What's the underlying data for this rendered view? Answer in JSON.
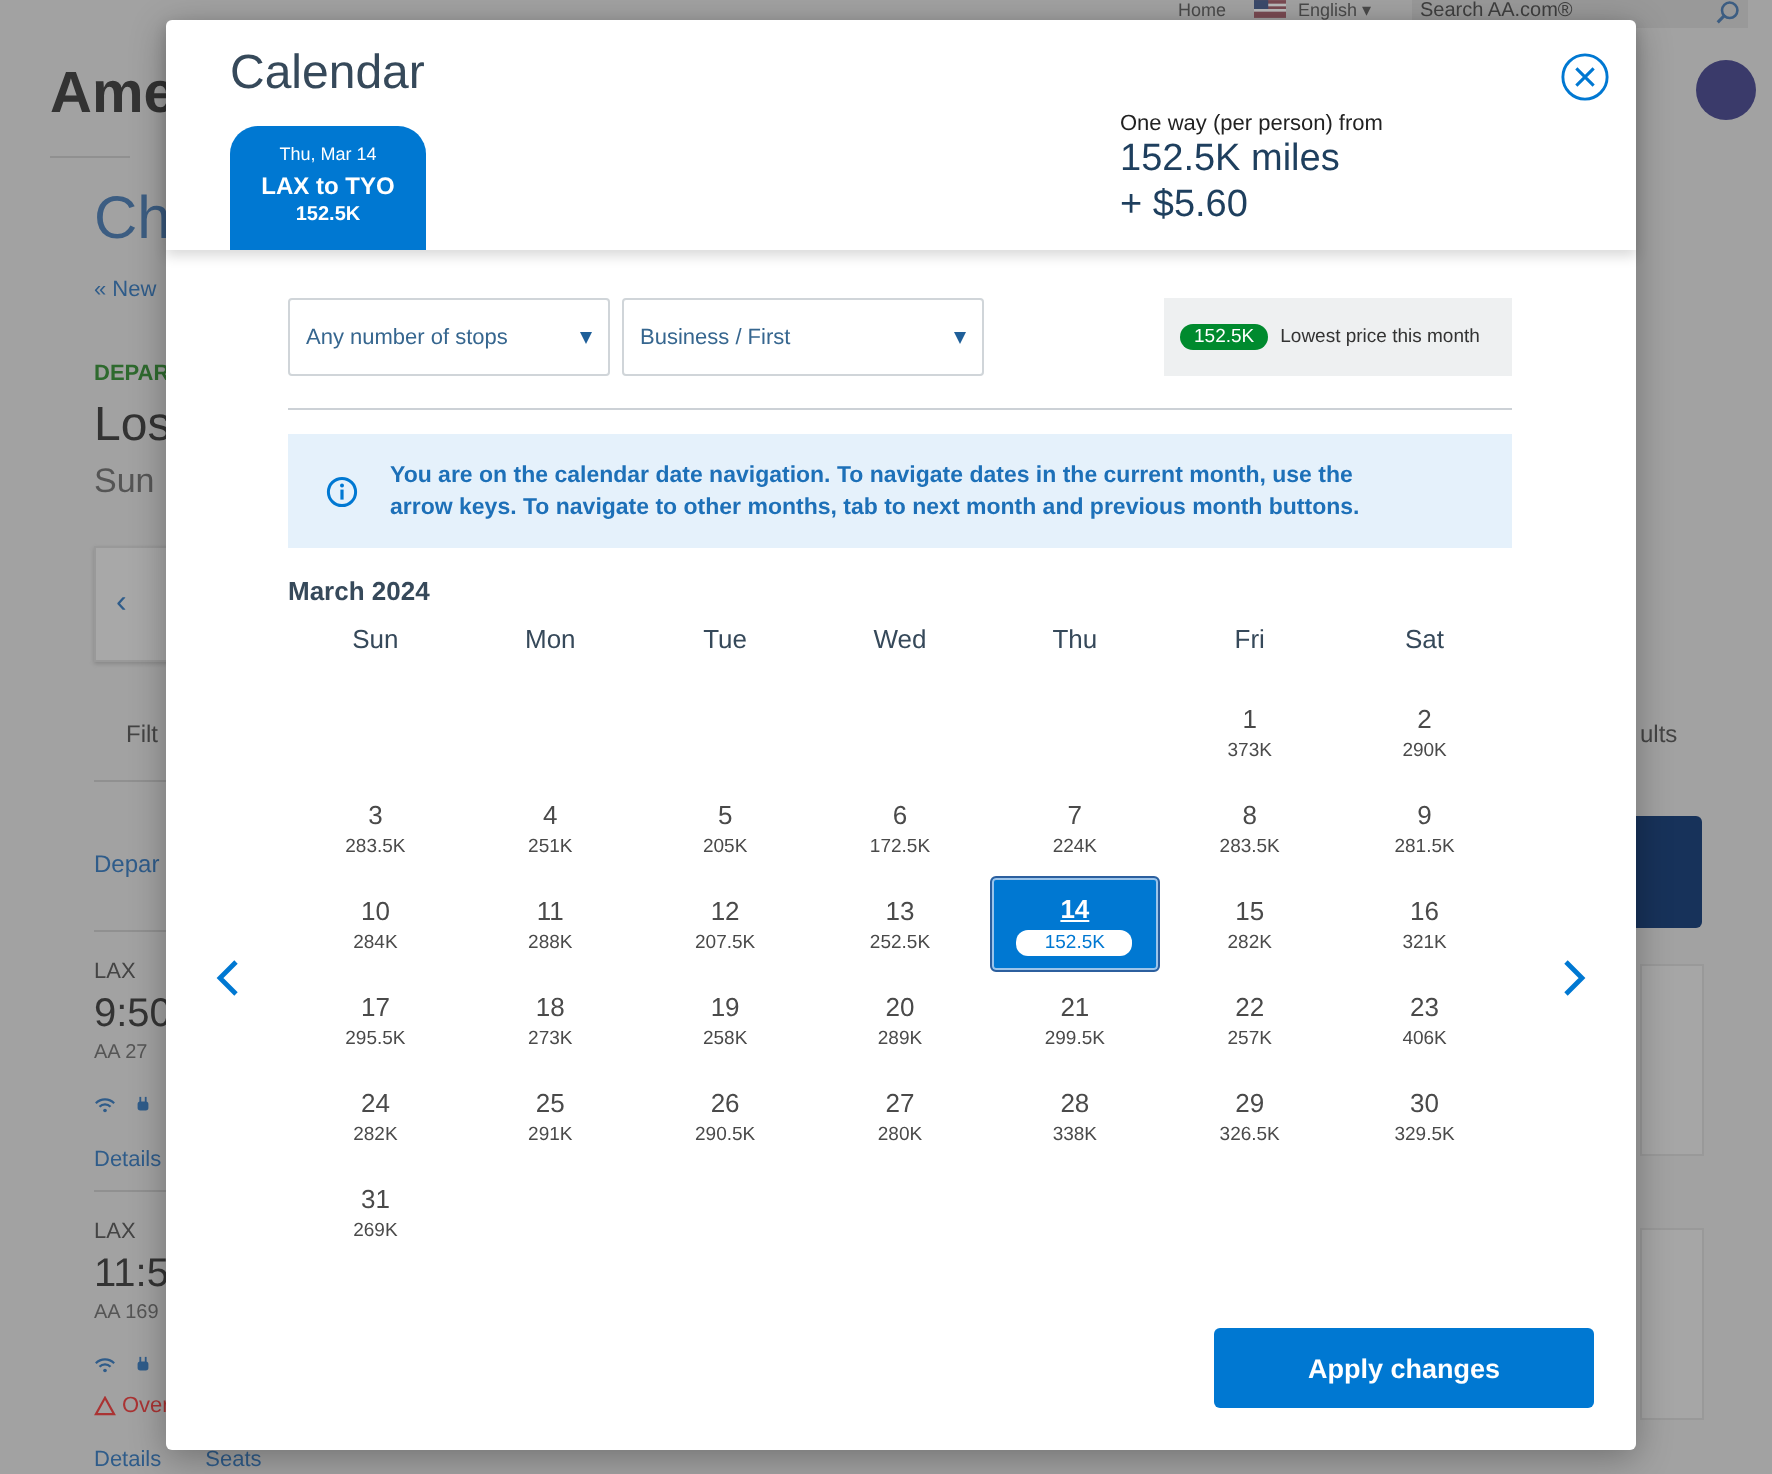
{
  "background": {
    "top_links": [
      "Home",
      "English ▾"
    ],
    "search": {
      "placeholder": "Search AA.com®"
    },
    "logo": "Ame",
    "heading": "Ch",
    "back_link": "« New",
    "section_label": "DEPAR",
    "city": "Los",
    "date": "Sun",
    "prev_arrow": "‹",
    "filter": "Filt",
    "results": "ults",
    "sort": "Depar",
    "flights": [
      {
        "origin": "LAX",
        "time": "9:50",
        "flight": "AA 27",
        "links": [
          "Details"
        ]
      },
      {
        "origin": "LAX",
        "time": "11:5",
        "flight": "AA 169",
        "warning": "Over",
        "links": [
          "Details",
          "Seats"
        ]
      }
    ]
  },
  "modal": {
    "title": "Calendar",
    "tab": {
      "date": "Thu, Mar 14",
      "route": "LAX to TYO",
      "price": "152.5K"
    },
    "fare": {
      "label": "One way (per person) from",
      "miles": "152.5K miles",
      "cash": "+ $5.60"
    },
    "filters": [
      {
        "value": "Any number of stops"
      },
      {
        "value": "Business / First"
      }
    ],
    "legend": {
      "badge": "152.5K",
      "text": "Lowest price this month"
    },
    "info": "You are on the calendar date navigation. To navigate dates in the current month, use the arrow keys. To navigate to other months, tab to next month and previous month buttons.",
    "month": "March 2024",
    "weekdays": [
      "Sun",
      "Mon",
      "Tue",
      "Wed",
      "Thu",
      "Fri",
      "Sat"
    ],
    "weeks": [
      [
        {
          "day": "1",
          "price": "373K",
          "selected": false,
          "lowest": false
        },
        {
          "day": "2",
          "price": "290K",
          "selected": false,
          "lowest": false
        }
      ],
      [
        {
          "day": "3",
          "price": "283.5K",
          "selected": false,
          "lowest": false
        },
        {
          "day": "4",
          "price": "251K",
          "selected": false,
          "lowest": false
        },
        {
          "day": "5",
          "price": "205K",
          "selected": false,
          "lowest": false
        },
        {
          "day": "6",
          "price": "172.5K",
          "selected": false,
          "lowest": false
        },
        {
          "day": "7",
          "price": "224K",
          "selected": false,
          "lowest": false
        },
        {
          "day": "8",
          "price": "283.5K",
          "selected": false,
          "lowest": false
        },
        {
          "day": "9",
          "price": "281.5K",
          "selected": false,
          "lowest": false
        }
      ],
      [
        {
          "day": "10",
          "price": "284K",
          "selected": false,
          "lowest": false
        },
        {
          "day": "11",
          "price": "288K",
          "selected": false,
          "lowest": false
        },
        {
          "day": "12",
          "price": "207.5K",
          "selected": false,
          "lowest": false
        },
        {
          "day": "13",
          "price": "252.5K",
          "selected": false,
          "lowest": false
        },
        {
          "day": "14",
          "price": "152.5K",
          "selected": true,
          "lowest": true
        },
        {
          "day": "15",
          "price": "282K",
          "selected": false,
          "lowest": false
        },
        {
          "day": "16",
          "price": "321K",
          "selected": false,
          "lowest": false
        }
      ],
      [
        {
          "day": "17",
          "price": "295.5K",
          "selected": false,
          "lowest": false
        },
        {
          "day": "18",
          "price": "273K",
          "selected": false,
          "lowest": false
        },
        {
          "day": "19",
          "price": "258K",
          "selected": false,
          "lowest": false
        },
        {
          "day": "20",
          "price": "289K",
          "selected": false,
          "lowest": false
        },
        {
          "day": "21",
          "price": "299.5K",
          "selected": false,
          "lowest": false
        },
        {
          "day": "22",
          "price": "257K",
          "selected": false,
          "lowest": false
        },
        {
          "day": "23",
          "price": "406K",
          "selected": false,
          "lowest": false
        }
      ],
      [
        {
          "day": "24",
          "price": "282K",
          "selected": false,
          "lowest": false
        },
        {
          "day": "25",
          "price": "291K",
          "selected": false,
          "lowest": false
        },
        {
          "day": "26",
          "price": "290.5K",
          "selected": false,
          "lowest": false
        },
        {
          "day": "27",
          "price": "280K",
          "selected": false,
          "lowest": false
        },
        {
          "day": "28",
          "price": "338K",
          "selected": false,
          "lowest": false
        },
        {
          "day": "29",
          "price": "326.5K",
          "selected": false,
          "lowest": false
        },
        {
          "day": "30",
          "price": "329.5K",
          "selected": false,
          "lowest": false
        }
      ],
      [
        {
          "day": "31",
          "price": "269K",
          "selected": false,
          "lowest": false
        }
      ]
    ],
    "apply_button": "Apply changes"
  }
}
